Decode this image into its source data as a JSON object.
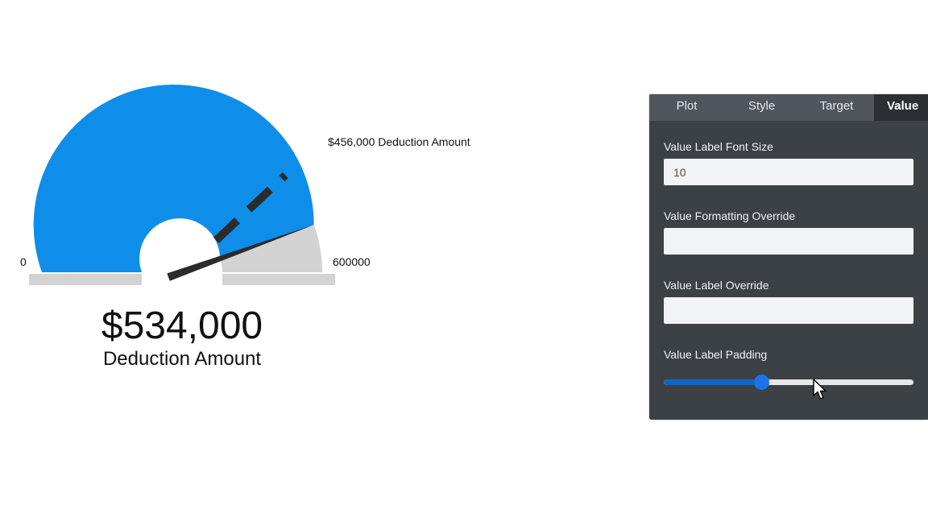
{
  "gauge": {
    "min": 0,
    "max": 600000,
    "value": 534000,
    "target": 456000,
    "min_label": "0",
    "max_label": "600000",
    "value_text": "$534,000",
    "value_caption": "Deduction Amount",
    "target_label": "$456,000 Deduction Amount",
    "fill_color": "#0f8ee9",
    "remainder_color": "#d3d3d3",
    "needle_color": "#2b2b2b"
  },
  "panel": {
    "tabs": [
      {
        "label": "Plot",
        "active": false
      },
      {
        "label": "Style",
        "active": false
      },
      {
        "label": "Target",
        "active": false
      },
      {
        "label": "Value",
        "active": true
      }
    ],
    "fields": {
      "font_size_label": "Value Label Font Size",
      "font_size_value": "10",
      "formatting_label": "Value Formatting Override",
      "formatting_value": "",
      "label_override_label": "Value Label Override",
      "label_override_value": "",
      "padding_label": "Value Label Padding"
    },
    "padding_slider": {
      "fraction": 0.39,
      "fill_color": "#1565c0",
      "thumb_color": "#1a73e8"
    },
    "background_color": "#3c4145"
  }
}
